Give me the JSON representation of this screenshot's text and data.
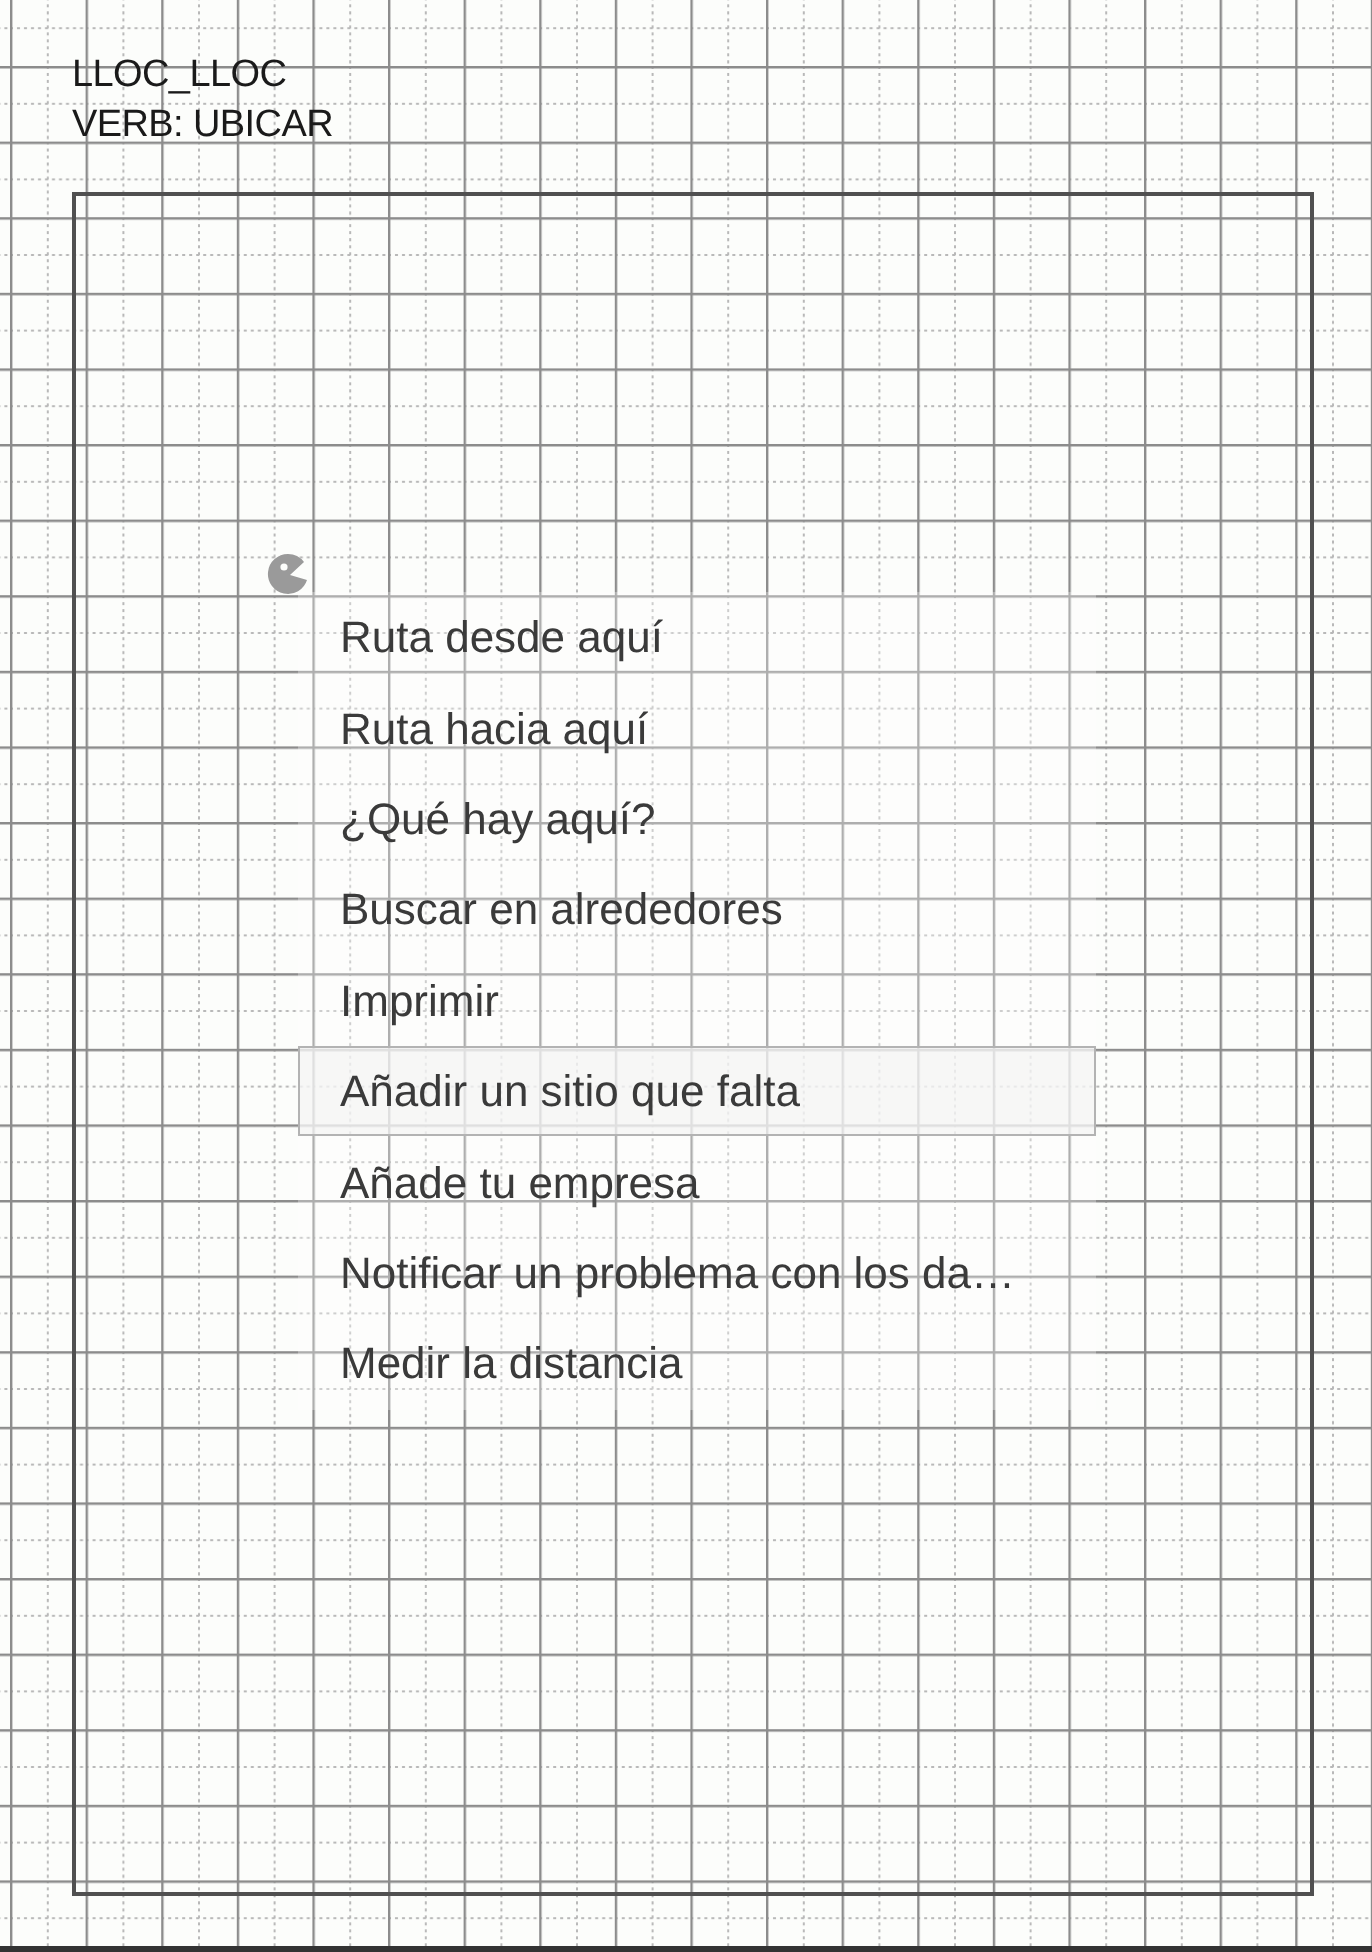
{
  "header": {
    "title": "LLOC_LLOC",
    "subtitle": "VERB: UBICAR"
  },
  "context_menu": {
    "items": [
      {
        "label": "Ruta desde aquí",
        "selected": false
      },
      {
        "label": "Ruta hacia aquí",
        "selected": false
      },
      {
        "label": "¿Qué hay aquí?",
        "selected": false
      },
      {
        "label": "Buscar en alrededores",
        "selected": false
      },
      {
        "label": "Imprimir",
        "selected": false
      },
      {
        "label": "Añadir un sitio que falta",
        "selected": true
      },
      {
        "label": "Añade tu empresa",
        "selected": false
      },
      {
        "label": "Notificar un problema con los da…",
        "selected": false
      },
      {
        "label": "Medir la distancia",
        "selected": false
      }
    ]
  }
}
